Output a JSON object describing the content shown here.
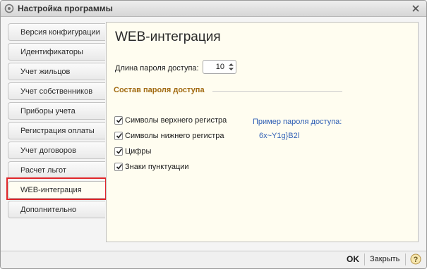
{
  "window": {
    "title": "Настройка программы"
  },
  "tabs": [
    {
      "label": "Версия конфигурации"
    },
    {
      "label": "Идентификаторы"
    },
    {
      "label": "Учет жильцов"
    },
    {
      "label": "Учет собственников"
    },
    {
      "label": "Приборы учета"
    },
    {
      "label": "Регистрация оплаты"
    },
    {
      "label": "Учет договоров"
    },
    {
      "label": "Расчет льгот"
    },
    {
      "label": "WEB-интеграция"
    },
    {
      "label": "Дополнительно"
    }
  ],
  "active_tab": "WEB-интеграция",
  "content": {
    "title": "WEB-интеграция",
    "password_length_label": "Длина пароля доступа:",
    "password_length_value": "10",
    "section_title": "Состав пароля доступа",
    "checkboxes": [
      {
        "label": "Символы верхнего регистра",
        "checked": true
      },
      {
        "label": "Символы нижнего регистра",
        "checked": true
      },
      {
        "label": "Цифры",
        "checked": true
      },
      {
        "label": "Знаки пунктуации",
        "checked": true
      }
    ],
    "example_label": "Пример пароля доступа:",
    "example_value": "6x~Y1g}B2l"
  },
  "footer": {
    "ok_label": "OK",
    "close_label": "Закрыть",
    "help_icon": "question-icon"
  },
  "colors": {
    "highlight": "#e0262a",
    "section_title": "#a26b12",
    "example_text": "#2f5fb5",
    "content_bg": "#fffdf0"
  }
}
